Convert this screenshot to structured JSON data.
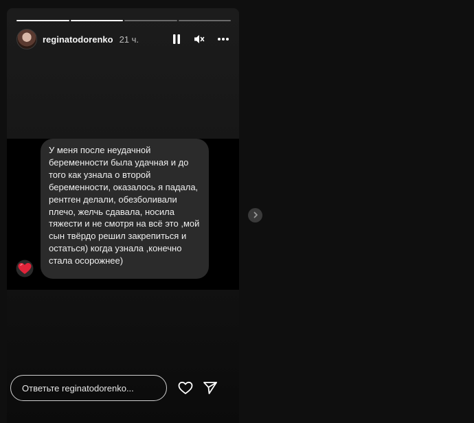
{
  "story": {
    "progress_segments": [
      {
        "state": "done"
      },
      {
        "state": "done"
      },
      {
        "state": "pending"
      },
      {
        "state": "pending"
      }
    ],
    "author": {
      "username": "reginatodorenko",
      "time_ago": "21 ч."
    },
    "header_icons": [
      "pause-icon",
      "mute-icon",
      "more-icon"
    ],
    "message": {
      "text": "У меня после неудачной беременности была удачная и до того как узнала о второй беременности, оказалось я падала, рентген делали, обезболивали плечо, желчь сдавала, носила тяжести и не смотря на всё это ,мой сын твёрдо решил закрепиться и остаться) когда узнала ,конечно стала осорожнее)",
      "reaction_icon": "heart-icon"
    },
    "reply": {
      "placeholder": "Ответьте reginatodorenko..."
    },
    "reply_icons": [
      "like-heart-icon",
      "send-icon"
    ]
  },
  "navigation": {
    "next_icon": "chevron-right-icon"
  },
  "colors": {
    "background": "#0f0f0f",
    "story_panel": "#161616",
    "bubble": "#2b2b2b",
    "reaction": "#e0243a"
  }
}
